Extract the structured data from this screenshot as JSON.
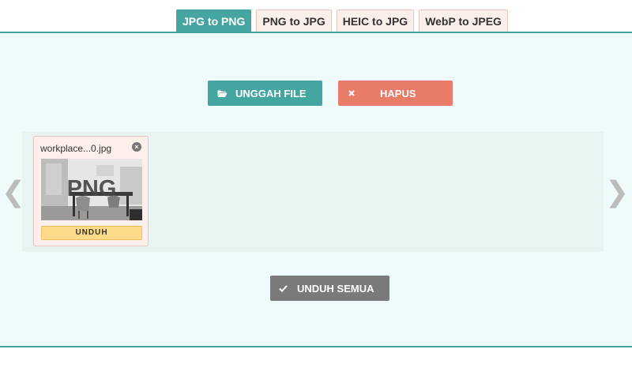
{
  "tabs": [
    {
      "label": "JPG to PNG",
      "active": true
    },
    {
      "label": "PNG to JPG",
      "active": false
    },
    {
      "label": "HEIC to JPG",
      "active": false
    },
    {
      "label": "WebP to JPEG",
      "active": false
    }
  ],
  "toolbar": {
    "upload_label": "UNGGAH FILE",
    "upload_icon": "folder-open-icon",
    "clear_label": "HAPUS",
    "clear_icon": "x-icon"
  },
  "files": [
    {
      "name": "workplace...0.jpg",
      "format_badge": "PNG",
      "download_label": "UNDUH"
    }
  ],
  "carousel": {
    "prev": "❮",
    "next": "❯"
  },
  "footer": {
    "download_all_label": "UNDUH SEMUA",
    "download_all_icon": "check-icon"
  },
  "colors": {
    "accent": "#45a5a1",
    "danger": "#e97c68",
    "neutral": "#7a7a7a",
    "download": "#fddb8b",
    "stage_bg": "#effbfa"
  }
}
